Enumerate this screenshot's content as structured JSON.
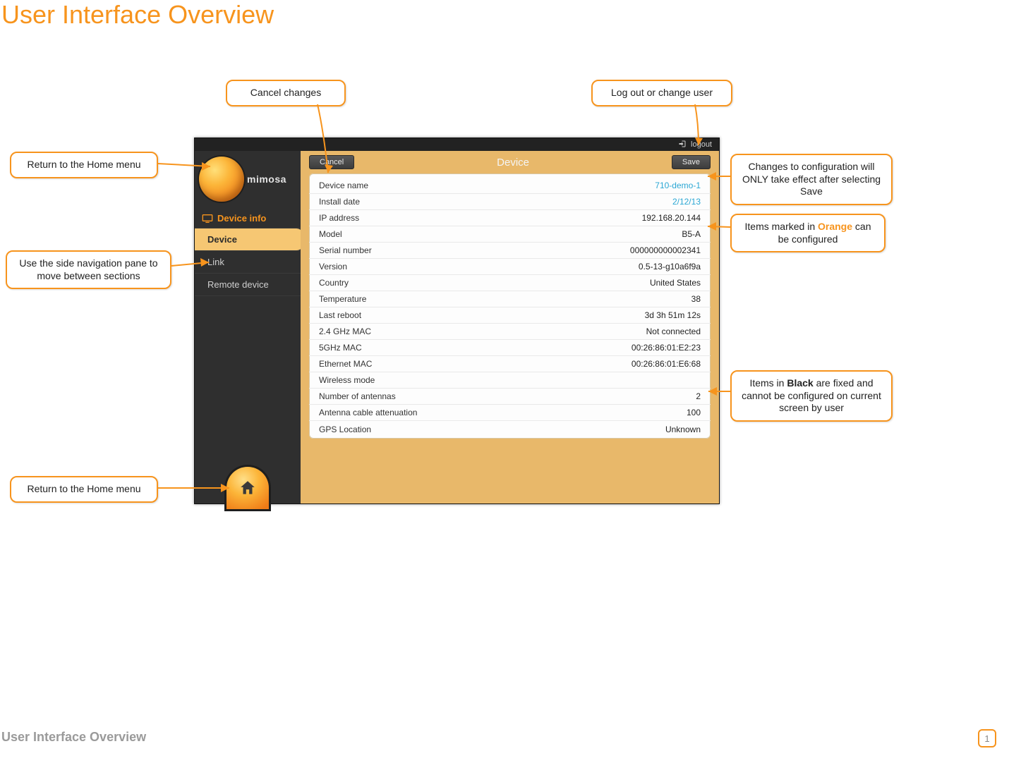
{
  "page": {
    "title": "User Interface Overview",
    "footer": "User Interface Overview",
    "page_number": "1"
  },
  "app": {
    "logout_label": "logout",
    "brand": "mimosa",
    "cancel_label": "Cancel",
    "save_label": "Save",
    "panel_title": "Device",
    "nav": {
      "section_label": "Device info",
      "items": [
        "Device",
        "Link",
        "Remote device"
      ],
      "active_index": 0
    },
    "fields": [
      {
        "label": "Device name",
        "value": "710-demo-1",
        "editable": true
      },
      {
        "label": "Install date",
        "value": "2/12/13",
        "editable": true
      },
      {
        "label": "IP address",
        "value": "192.168.20.144",
        "editable": false
      },
      {
        "label": "Model",
        "value": "B5-A",
        "editable": false
      },
      {
        "label": "Serial number",
        "value": "000000000002341",
        "editable": false
      },
      {
        "label": "Version",
        "value": "0.5-13-g10a6f9a",
        "editable": false
      },
      {
        "label": "Country",
        "value": "United States",
        "editable": false
      },
      {
        "label": "Temperature",
        "value": "38",
        "editable": false
      },
      {
        "label": "Last reboot",
        "value": "3d 3h 51m 12s",
        "editable": false
      },
      {
        "label": "2.4 GHz MAC",
        "value": "Not connected",
        "editable": false
      },
      {
        "label": "5GHz MAC",
        "value": "00:26:86:01:E2:23",
        "editable": false
      },
      {
        "label": "Ethernet MAC",
        "value": "00:26:86:01:E6:68",
        "editable": false
      },
      {
        "label": "Wireless mode",
        "value": "",
        "editable": false
      },
      {
        "label": "Number of antennas",
        "value": "2",
        "editable": false
      },
      {
        "label": "Antenna cable attenuation",
        "value": "100",
        "editable": false
      },
      {
        "label": "GPS Location",
        "value": "Unknown",
        "editable": false
      }
    ]
  },
  "callouts": {
    "cancel": "Cancel changes",
    "logout": "Log out or change user",
    "home_top": "Return to the Home menu",
    "sidenav": "Use the side navigation pane to move between sections",
    "home_bottom": "Return to the Home menu",
    "save_pre": "Changes to configuration will ONLY take effect after selecting ",
    "save_last": "Save",
    "orange_pre": "Items marked in ",
    "orange_word": "Orange",
    "orange_post": " can be configured",
    "black_pre": "Items in ",
    "black_word": "Black",
    "black_post": " are fixed and cannot be configured on current screen by user"
  }
}
